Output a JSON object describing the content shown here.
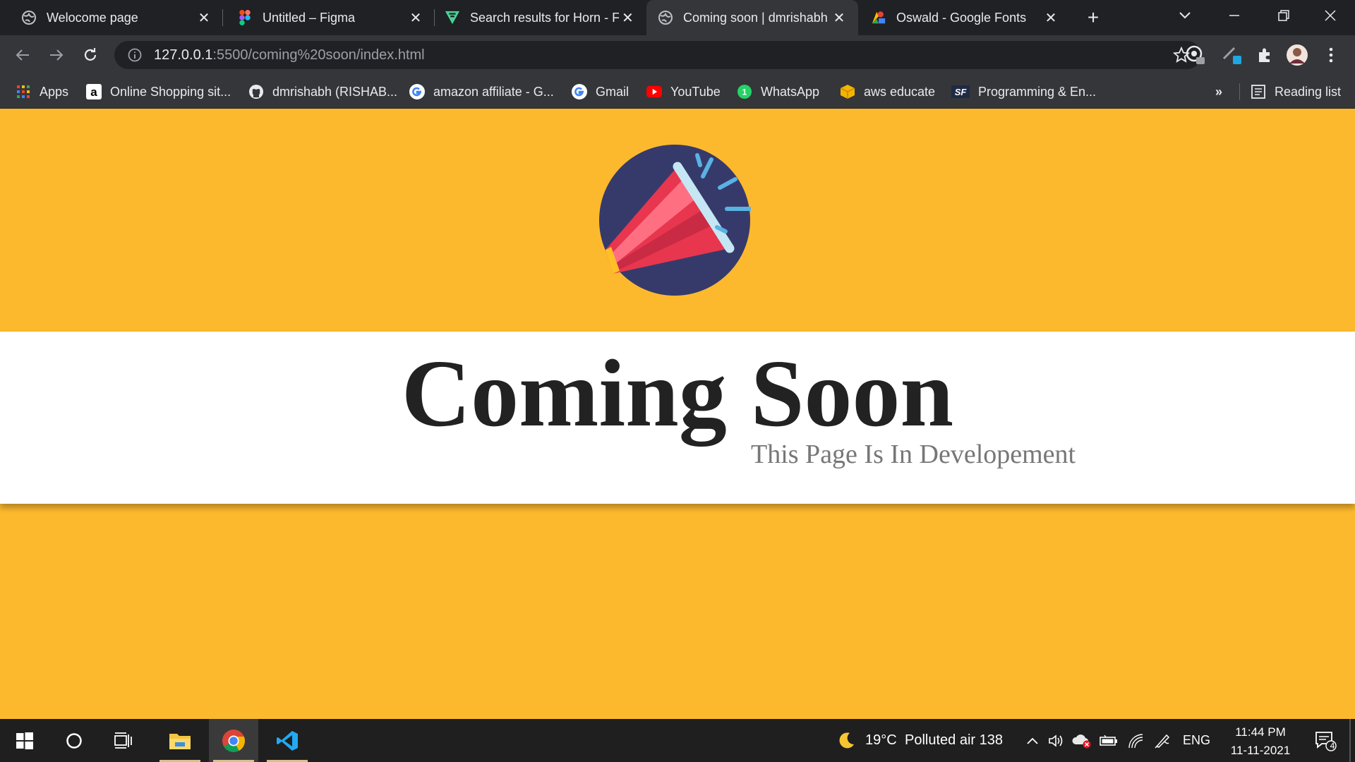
{
  "browser": {
    "tabs": [
      {
        "title": "Welocome page",
        "icon": "globe-icon",
        "active": false
      },
      {
        "title": "Untitled – Figma",
        "icon": "figma-icon",
        "active": false
      },
      {
        "title": "Search results for Horn - Fl",
        "icon": "flaticon-icon",
        "active": false
      },
      {
        "title": "Coming soon | dmrishabh",
        "icon": "globe-icon",
        "active": true
      },
      {
        "title": "Oswald - Google Fonts",
        "icon": "google-fonts-icon",
        "active": false
      }
    ],
    "address": {
      "host": "127.0.0.1",
      "rest": ":5500/coming%20soon/index.html"
    },
    "bookmarks": [
      {
        "label": "Apps",
        "icon": "apps-grid-icon"
      },
      {
        "label": "Online Shopping sit...",
        "icon": "amazon-icon"
      },
      {
        "label": "dmrishabh (RISHAB...",
        "icon": "github-icon"
      },
      {
        "label": "amazon affiliate - G...",
        "icon": "google-icon"
      },
      {
        "label": "Gmail",
        "icon": "google-icon"
      },
      {
        "label": "YouTube",
        "icon": "youtube-icon"
      },
      {
        "label": "WhatsApp",
        "icon": "whatsapp-icon"
      },
      {
        "label": "aws educate",
        "icon": "package-icon"
      },
      {
        "label": "Programming & En...",
        "icon": "sf-icon"
      }
    ],
    "bookmarks_overflow": "»",
    "reading_list": "Reading list"
  },
  "page": {
    "headline": "Coming Soon",
    "tagline": "This Page Is In Developement",
    "colors": {
      "background": "#fdb92e",
      "band": "#ffffff",
      "logo_circle": "#363a6b",
      "megaphone": "#e8364f"
    }
  },
  "taskbar": {
    "weather": {
      "temp": "19°C",
      "status": "Polluted air 138"
    },
    "language": "ENG",
    "time": "11:44 PM",
    "date": "11-11-2021",
    "notifications": "4"
  }
}
